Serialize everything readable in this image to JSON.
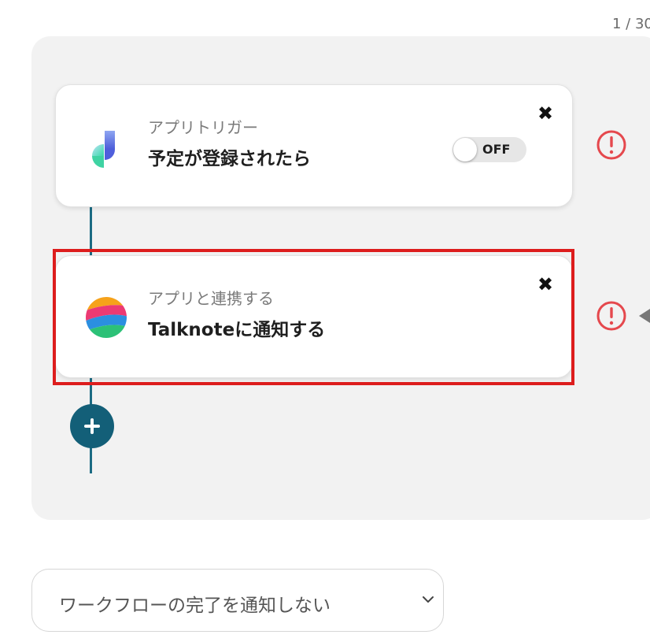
{
  "pager": {
    "text": "1 / 30"
  },
  "steps": [
    {
      "kind": "アプリトリガー",
      "title": "予定が登録されたら",
      "close_symbol": "✖",
      "icon": "calendar-app-icon",
      "toggle": {
        "label": "OFF",
        "on": false
      },
      "warning_icon": "exclamation-circle-icon"
    },
    {
      "kind": "アプリと連携する",
      "title": "Talknoteに通知する",
      "close_symbol": "✖",
      "icon": "talknote-app-icon",
      "highlighted": true,
      "warning_icon": "exclamation-circle-icon"
    }
  ],
  "add_step": {
    "icon": "plus-icon"
  },
  "notify_select": {
    "value": "ワークフローの完了を通知しない",
    "icon": "chevron-down-icon"
  },
  "colors": {
    "canvas_bg": "#f2f2f2",
    "connector": "#1b6b83",
    "add_button": "#135f78",
    "highlight": "#dd1d1d",
    "warning": "#e5484d"
  }
}
